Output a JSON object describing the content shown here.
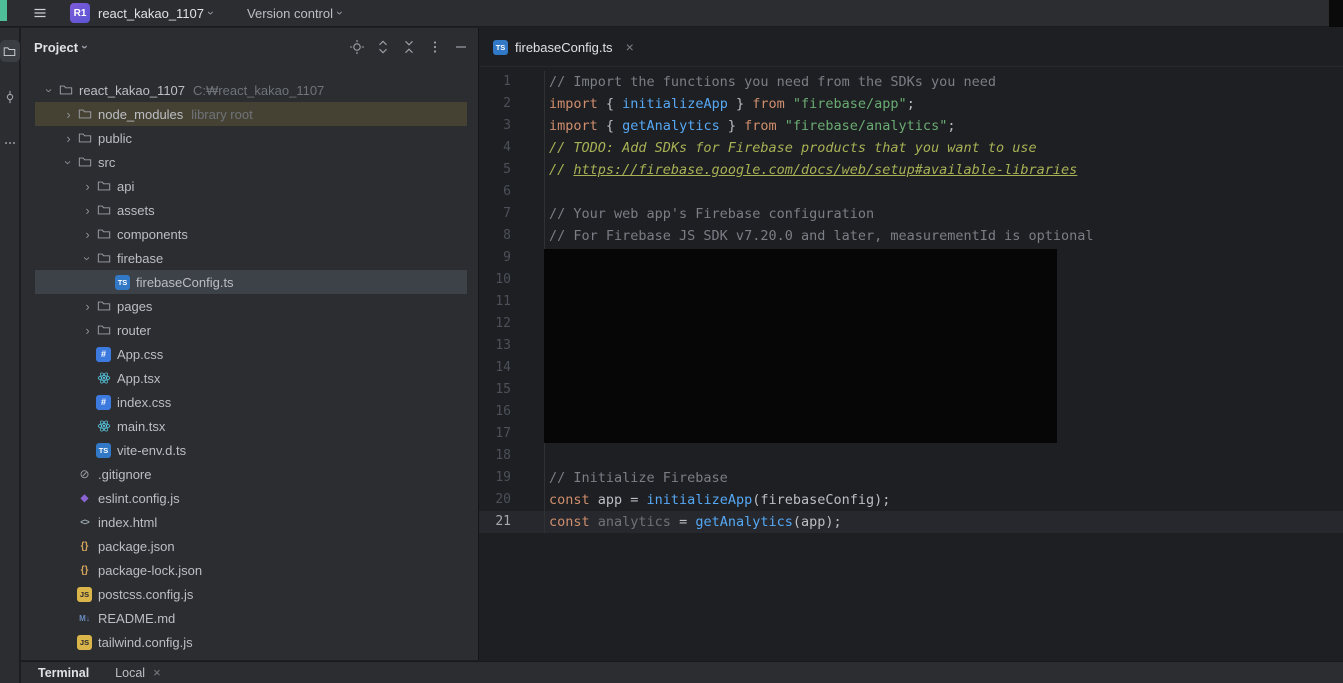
{
  "topbar": {
    "badge": "R1",
    "project_name": "react_kakao_1107",
    "version_control": "Version control"
  },
  "tool_strip": {
    "icons": [
      "project-folder",
      "commit",
      "more-tool-windows"
    ]
  },
  "project_panel": {
    "title": "Project",
    "header_icons": [
      "select-opened-file",
      "expand-all",
      "collapse-all",
      "options",
      "hide"
    ],
    "tree": [
      {
        "label": "react_kakao_1107",
        "note": "C:₩react_kakao_1107",
        "depth": 0,
        "icon": "folder",
        "chev": "open"
      },
      {
        "label": "node_modules",
        "note": "library root",
        "depth": 1,
        "icon": "folder",
        "chev": "closed",
        "hl": "lib"
      },
      {
        "label": "public",
        "depth": 1,
        "icon": "folder",
        "chev": "closed"
      },
      {
        "label": "src",
        "depth": 1,
        "icon": "folder",
        "chev": "open"
      },
      {
        "label": "api",
        "depth": 2,
        "icon": "folder",
        "chev": "closed"
      },
      {
        "label": "assets",
        "depth": 2,
        "icon": "folder",
        "chev": "closed"
      },
      {
        "label": "components",
        "depth": 2,
        "icon": "folder",
        "chev": "closed"
      },
      {
        "label": "firebase",
        "depth": 2,
        "icon": "folder",
        "chev": "open"
      },
      {
        "label": "firebaseConfig.ts",
        "depth": 3,
        "icon": "ts",
        "chev": "none",
        "sel": true
      },
      {
        "label": "pages",
        "depth": 2,
        "icon": "folder",
        "chev": "closed"
      },
      {
        "label": "router",
        "depth": 2,
        "icon": "folder",
        "chev": "closed"
      },
      {
        "label": "App.css",
        "depth": 2,
        "icon": "css",
        "chev": "none"
      },
      {
        "label": "App.tsx",
        "depth": 2,
        "icon": "react",
        "chev": "none"
      },
      {
        "label": "index.css",
        "depth": 2,
        "icon": "css",
        "chev": "none"
      },
      {
        "label": "main.tsx",
        "depth": 2,
        "icon": "react",
        "chev": "none"
      },
      {
        "label": "vite-env.d.ts",
        "depth": 2,
        "icon": "ts",
        "chev": "none"
      },
      {
        "label": ".gitignore",
        "depth": 1,
        "icon": "ignore",
        "chev": "none"
      },
      {
        "label": "eslint.config.js",
        "depth": 1,
        "icon": "eslint",
        "chev": "none"
      },
      {
        "label": "index.html",
        "depth": 1,
        "icon": "html",
        "chev": "none"
      },
      {
        "label": "package.json",
        "depth": 1,
        "icon": "json",
        "chev": "none"
      },
      {
        "label": "package-lock.json",
        "depth": 1,
        "icon": "json",
        "chev": "none"
      },
      {
        "label": "postcss.config.js",
        "depth": 1,
        "icon": "js",
        "chev": "none"
      },
      {
        "label": "README.md",
        "depth": 1,
        "icon": "md",
        "chev": "none"
      },
      {
        "label": "tailwind.config.js",
        "depth": 1,
        "icon": "js",
        "chev": "none"
      }
    ]
  },
  "editor": {
    "tab_label": "firebaseConfig.ts",
    "tab_close": "×",
    "redaction": {
      "covers_lines": "9-17"
    },
    "lines": [
      {
        "n": 1,
        "seg": [
          [
            "// Import the functions you need from the SDKs you need",
            "c"
          ]
        ]
      },
      {
        "n": 2,
        "seg": [
          [
            "import",
            "k"
          ],
          [
            " { ",
            "d"
          ],
          [
            "initializeApp",
            "f"
          ],
          [
            " } ",
            "d"
          ],
          [
            "from",
            "k"
          ],
          [
            " ",
            "d"
          ],
          [
            "\"firebase/app\"",
            "s"
          ],
          [
            ";",
            "d"
          ]
        ]
      },
      {
        "n": 3,
        "seg": [
          [
            "import",
            "k"
          ],
          [
            " { ",
            "d"
          ],
          [
            "getAnalytics",
            "f"
          ],
          [
            " } ",
            "d"
          ],
          [
            "from",
            "k"
          ],
          [
            " ",
            "d"
          ],
          [
            "\"firebase/analytics\"",
            "s"
          ],
          [
            ";",
            "d"
          ]
        ]
      },
      {
        "n": 4,
        "seg": [
          [
            "// TODO: Add SDKs for Firebase products that you want to use",
            "t"
          ]
        ]
      },
      {
        "n": 5,
        "seg": [
          [
            "// ",
            "t"
          ],
          [
            "https://firebase.google.com/docs/web/setup#available-libraries",
            "tl"
          ]
        ]
      },
      {
        "n": 6,
        "seg": []
      },
      {
        "n": 7,
        "seg": [
          [
            "// Your web app's Firebase configuration",
            "c"
          ]
        ]
      },
      {
        "n": 8,
        "seg": [
          [
            "// For Firebase JS SDK v7.20.0 and later, measurementId is optional",
            "c"
          ]
        ]
      },
      {
        "n": 9,
        "seg": []
      },
      {
        "n": 10,
        "seg": []
      },
      {
        "n": 11,
        "seg": []
      },
      {
        "n": 12,
        "seg": []
      },
      {
        "n": 13,
        "seg": []
      },
      {
        "n": 14,
        "seg": []
      },
      {
        "n": 15,
        "seg": []
      },
      {
        "n": 16,
        "seg": []
      },
      {
        "n": 17,
        "seg": []
      },
      {
        "n": 18,
        "seg": []
      },
      {
        "n": 19,
        "seg": [
          [
            "// Initialize Firebase",
            "c"
          ]
        ]
      },
      {
        "n": 20,
        "seg": [
          [
            "const",
            "k"
          ],
          [
            " app = ",
            "d"
          ],
          [
            "initializeApp",
            "f"
          ],
          [
            "(firebaseConfig);",
            "d"
          ]
        ]
      },
      {
        "n": 21,
        "cur": true,
        "seg": [
          [
            "const",
            "k"
          ],
          [
            " ",
            "d"
          ],
          [
            "analytics",
            "u"
          ],
          [
            " = ",
            "d"
          ],
          [
            "getAnalytics",
            "f"
          ],
          [
            "(app);",
            "d"
          ]
        ]
      }
    ]
  },
  "bottom": {
    "terminal": "Terminal",
    "local_tab": "Local",
    "local_close": "×"
  }
}
